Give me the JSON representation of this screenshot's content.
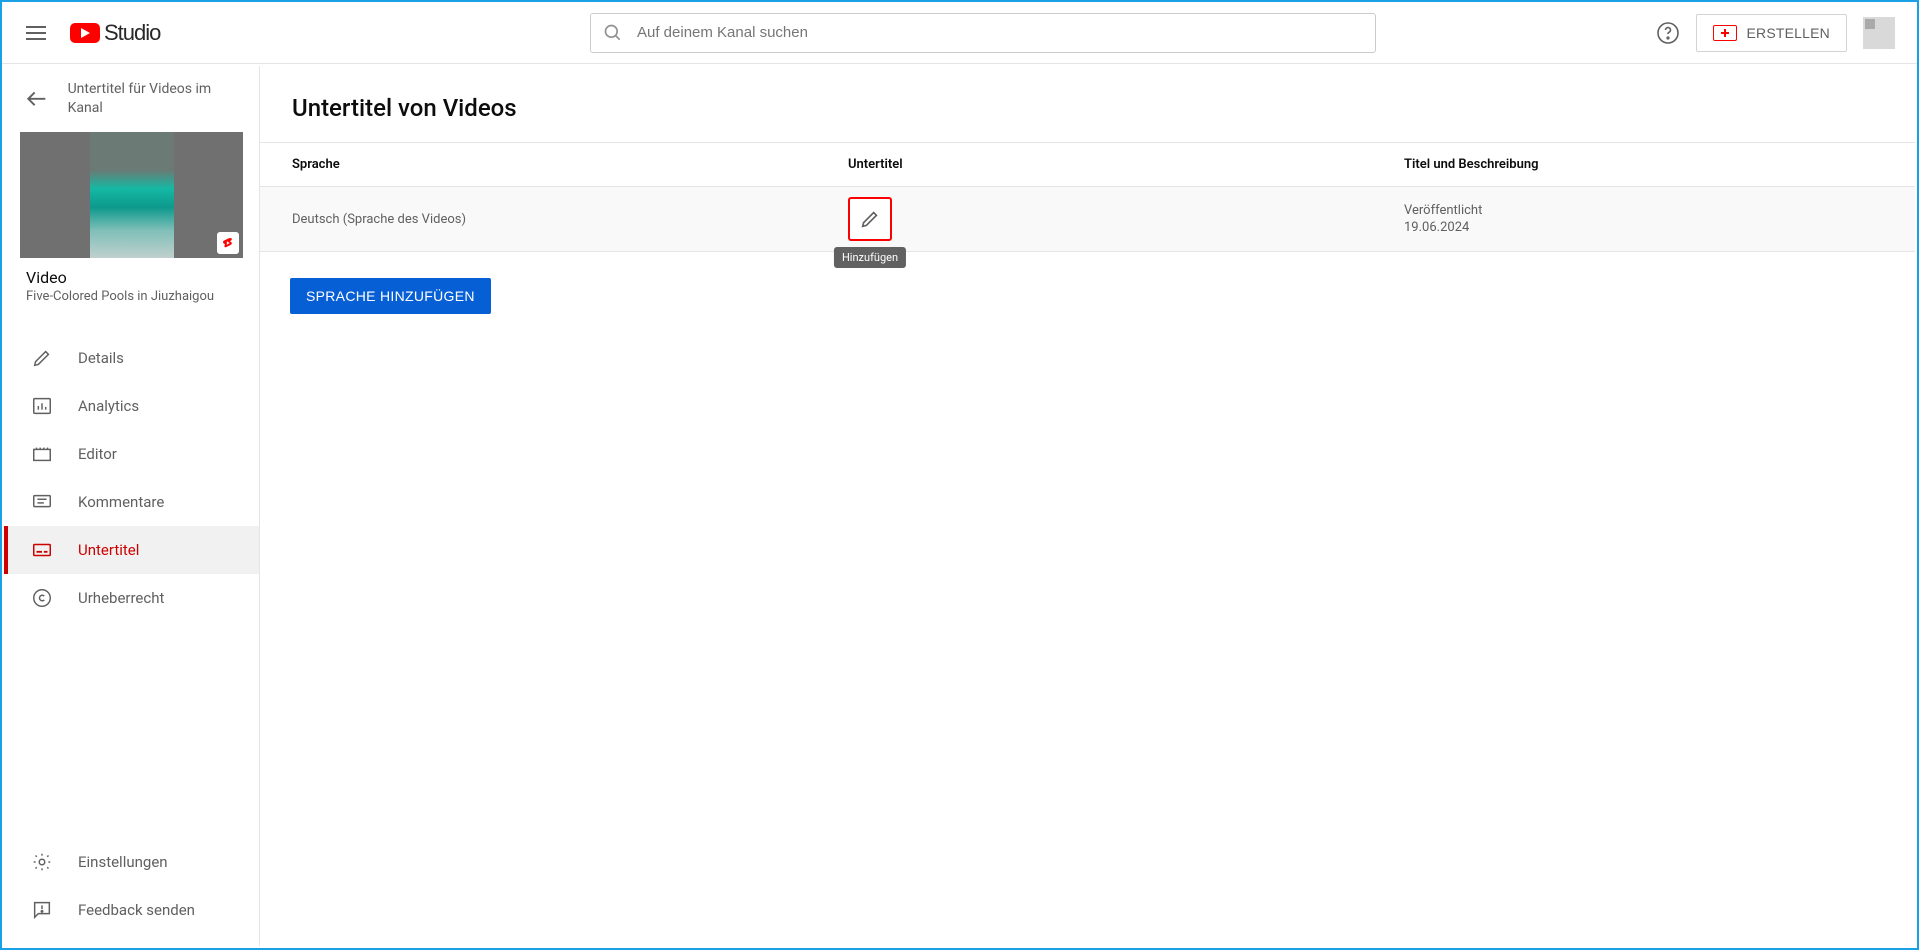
{
  "header": {
    "logo_text": "Studio",
    "search_placeholder": "Auf deinem Kanal suchen",
    "create_label": "ERSTELLEN"
  },
  "sidebar": {
    "back_label": "Untertitel für Videos im Kanal",
    "video_label": "Video",
    "video_title": "Five-Colored Pools in Jiuzhaigou",
    "nav": {
      "details": "Details",
      "analytics": "Analytics",
      "editor": "Editor",
      "comments": "Kommentare",
      "subtitles": "Untertitel",
      "copyright": "Urheberrecht",
      "settings": "Einstellungen",
      "feedback": "Feedback senden"
    }
  },
  "main": {
    "title": "Untertitel von Videos",
    "columns": {
      "language": "Sprache",
      "subtitles": "Untertitel",
      "titledesc": "Titel und Beschreibung"
    },
    "row": {
      "language": "Deutsch (Sprache des Videos)",
      "tooltip": "Hinzufügen",
      "status": "Veröffentlicht",
      "date": "19.06.2024"
    },
    "add_language_btn": "SPRACHE HINZUFÜGEN"
  }
}
